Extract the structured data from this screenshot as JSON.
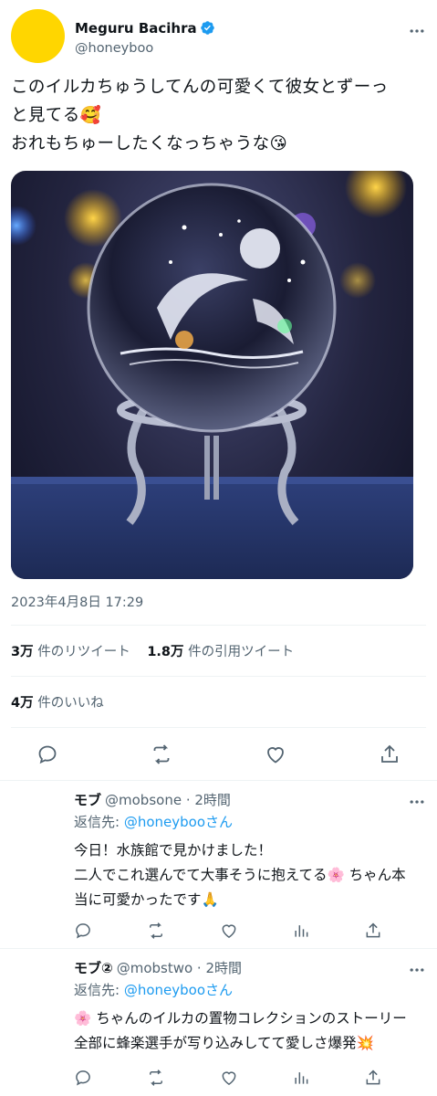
{
  "tweet": {
    "author_name": "Meguru Bacihra",
    "author_handle": "@honeyboo",
    "avatar_color": "#ffd600",
    "text_lines": [
      "このイルカちゅうしてんの可愛くて彼女とずーっ",
      "と見てる🥰",
      "おれもちゅーしたくなっちゃうな😘"
    ],
    "media_icon": "crystal-ball-dolphin-photo",
    "timestamp": "2023年4月8日 17:29",
    "retweets_count": "3万",
    "retweets_label": "件のリツイート",
    "quotes_count": "1.8万",
    "quotes_label": "件の引用ツイート",
    "likes_count": "4万",
    "likes_label": "件のいいね"
  },
  "replies": [
    {
      "name": "モブ",
      "handle": "@mobsone · 2時間",
      "replying_prefix": "返信先: ",
      "replying_to": "@honeybooさん",
      "lines": [
        "今日！水族館で見かけました！",
        "二人でこれ選んでて大事そうに抱えてる🌸 ちゃん本",
        "当に可愛かったです🙏"
      ]
    },
    {
      "name": "モブ②",
      "handle": "@mobstwo · 2時間",
      "replying_prefix": "返信先: ",
      "replying_to": "@honeybooさん",
      "lines": [
        "🌸 ちゃんのイルカの置物コレクションのストーリー",
        "全部に蜂楽選手が写り込みしてて愛しさ爆発💥"
      ]
    }
  ],
  "colors": {
    "accent": "#1d9bf0",
    "secondary_text": "#536471",
    "divider": "#eff3f4"
  }
}
